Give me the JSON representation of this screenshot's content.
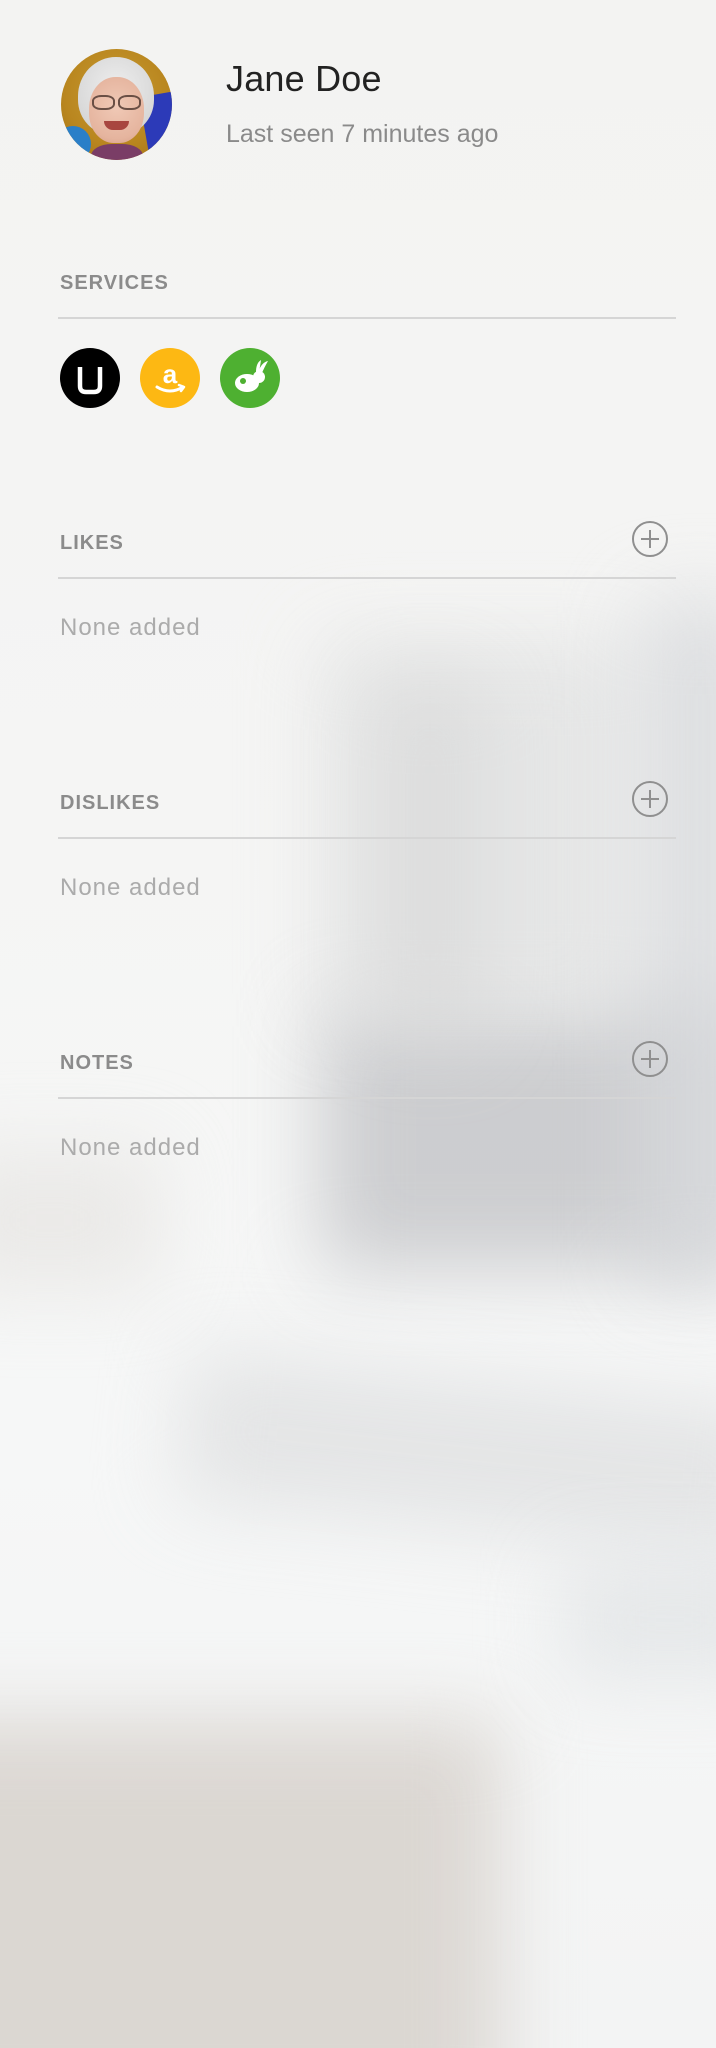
{
  "profile": {
    "name": "Jane Doe",
    "last_seen": "Last seen 7 minutes ago"
  },
  "services": {
    "title": "SERVICES",
    "items": [
      {
        "name": "uber-icon",
        "color": "#000000"
      },
      {
        "name": "amazon-icon",
        "color": "#FDB813"
      },
      {
        "name": "taskrabbit-icon",
        "color": "#4EB031"
      }
    ]
  },
  "likes": {
    "title": "LIKES",
    "empty_text": "None added"
  },
  "dislikes": {
    "title": "DISLIKES",
    "empty_text": "None added"
  },
  "notes": {
    "title": "NOTES",
    "empty_text": "None added"
  },
  "colors": {
    "section_title": "#8B8B8B",
    "empty_text": "#ABABAB",
    "divider": "#D5D5D5"
  }
}
